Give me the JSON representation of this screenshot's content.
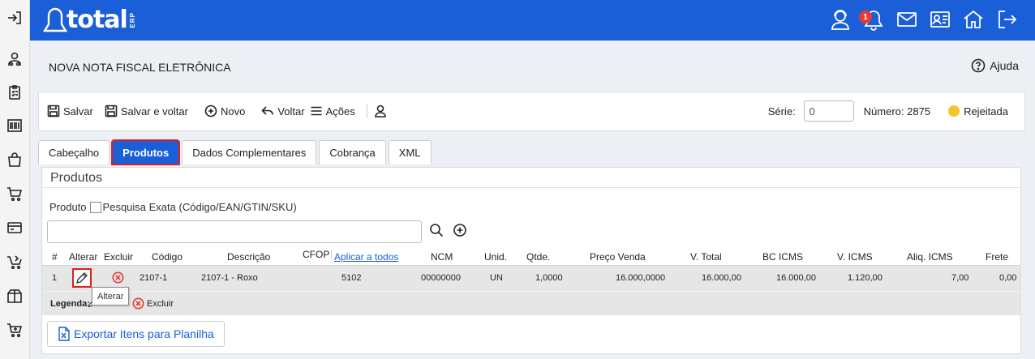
{
  "header": {
    "logo_text": "total",
    "logo_suffix": "ERP",
    "notification_count": "1",
    "icons": [
      "support-agent-icon",
      "bell-icon",
      "mail-icon",
      "contact-card-icon",
      "home-icon",
      "logout-icon"
    ]
  },
  "sidebar": {
    "icons": [
      "sign-in-icon",
      "users-icon",
      "clipboard-list-icon",
      "barcode-icon",
      "shopping-bag-icon",
      "cart-icon",
      "credit-card-icon",
      "cart-arrow-icon",
      "box-icon",
      "cart-plus-icon"
    ]
  },
  "page": {
    "title": "NOVA NOTA FISCAL ELETRÔNICA",
    "help_label": "Ajuda"
  },
  "toolbar": {
    "save_label": "Salvar",
    "save_back_label": "Salvar e voltar",
    "new_label": "Novo",
    "back_label": "Voltar",
    "actions_label": "Ações",
    "serie_label": "Série:",
    "serie_value": "0",
    "numero_label": "Número: 2875",
    "status_label": "Rejeitada",
    "status_color": "#f5c32c"
  },
  "tabs": [
    {
      "label": "Cabeçalho"
    },
    {
      "label": "Produtos"
    },
    {
      "label": "Dados Complementares"
    },
    {
      "label": "Cobrança"
    },
    {
      "label": "XML"
    }
  ],
  "products": {
    "title": "Produtos",
    "product_label": "Produto",
    "exact_search_label": "Pesquisa Exata (Código/EAN/GTIN/SKU)",
    "search_value": "",
    "columns": {
      "num": "#",
      "alterar": "Alterar",
      "excluir": "Excluir",
      "codigo": "Código",
      "descricao": "Descrição",
      "cfop": "CFOP",
      "aplicar": "Aplicar a todos",
      "ncm": "NCM",
      "unid": "Unid.",
      "qtde": "Qtde.",
      "preco": "Preço Venda",
      "vtotal": "V. Total",
      "bcicms": "BC ICMS",
      "vicms": "V. ICMS",
      "aliq": "Aliq. ICMS",
      "frete": "Frete"
    },
    "row": {
      "num": "1",
      "codigo": "2107-1",
      "descricao": "2107-1 - Roxo",
      "cfop": "5102",
      "ncm": "00000000",
      "unid": "UN",
      "qtde": "1,0000",
      "preco": "16.000,0000",
      "vtotal": "16.000,00",
      "bcicms": "16.000,00",
      "vicms": "1.120,00",
      "aliq": "7,00",
      "frete": "0,00"
    },
    "legend_label": "Legenda:",
    "legend_delete": "Excluir",
    "tooltip": "Alterar",
    "export_label": "Exportar Itens para Planilha"
  }
}
